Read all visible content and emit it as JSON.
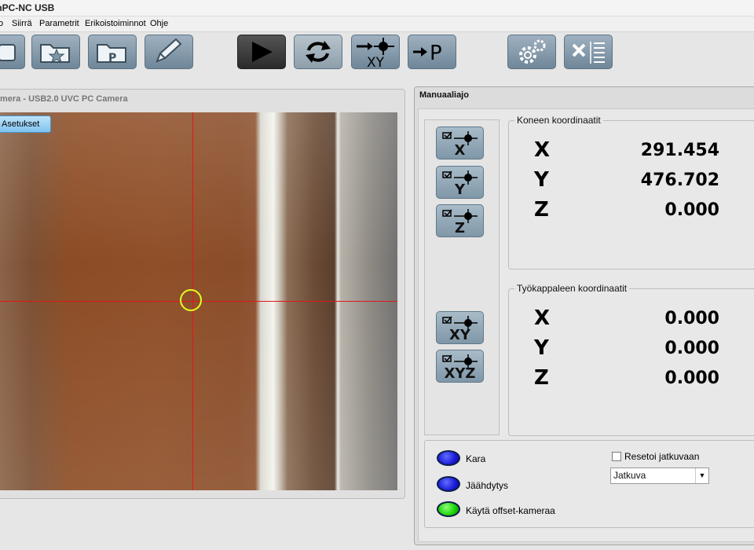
{
  "app": {
    "title": "mPC-NC USB"
  },
  "menu": {
    "items": [
      "o",
      "Siirrä",
      "Parametrit",
      "Erikoistoiminnot",
      "Ohje"
    ]
  },
  "toolbar": {
    "buttons": [
      {
        "name": "open-file",
        "icon": "folder-icon"
      },
      {
        "name": "favorites",
        "icon": "folder-star-icon"
      },
      {
        "name": "program-folder",
        "icon": "folder-p-icon",
        "glyph": "P"
      },
      {
        "name": "edit",
        "icon": "pencil-icon"
      },
      {
        "name": "run",
        "icon": "play-icon"
      },
      {
        "name": "repeat",
        "icon": "refresh-icon"
      },
      {
        "name": "goto-xy-zero",
        "icon": "goto-xy-icon",
        "glyph": "XY"
      },
      {
        "name": "goto-park",
        "icon": "goto-p-icon",
        "glyph": "P"
      },
      {
        "name": "settings",
        "icon": "gears-icon"
      },
      {
        "name": "tools",
        "icon": "tools-list-icon"
      }
    ]
  },
  "camera": {
    "title": "mera - USB2.0 UVC PC Camera",
    "settings_button": "Asetukset"
  },
  "manual": {
    "title": "Manuaaliajo",
    "zero_buttons": [
      "X",
      "Y",
      "Z",
      "XY",
      "XYZ"
    ],
    "machine": {
      "title": "Koneen koordinaatit",
      "axes": [
        {
          "axis": "X",
          "value": "291.454"
        },
        {
          "axis": "Y",
          "value": "476.702"
        },
        {
          "axis": "Z",
          "value": "0.000"
        }
      ]
    },
    "workpiece": {
      "title": "Työkappaleen koordinaatit",
      "axes": [
        {
          "axis": "X",
          "value": "0.000"
        },
        {
          "axis": "Y",
          "value": "0.000"
        },
        {
          "axis": "Z",
          "value": "0.000"
        }
      ]
    },
    "controls": {
      "spindle": "Kara",
      "coolant": "Jäähdytys",
      "offset_camera": "Käytä offset-kameraa",
      "reset_continuous": "Resetoi jatkuvaan",
      "mode_value": "Jatkuva"
    },
    "colors": {
      "led_blue": "#1a1ad6",
      "led_green": "#16d100"
    }
  }
}
